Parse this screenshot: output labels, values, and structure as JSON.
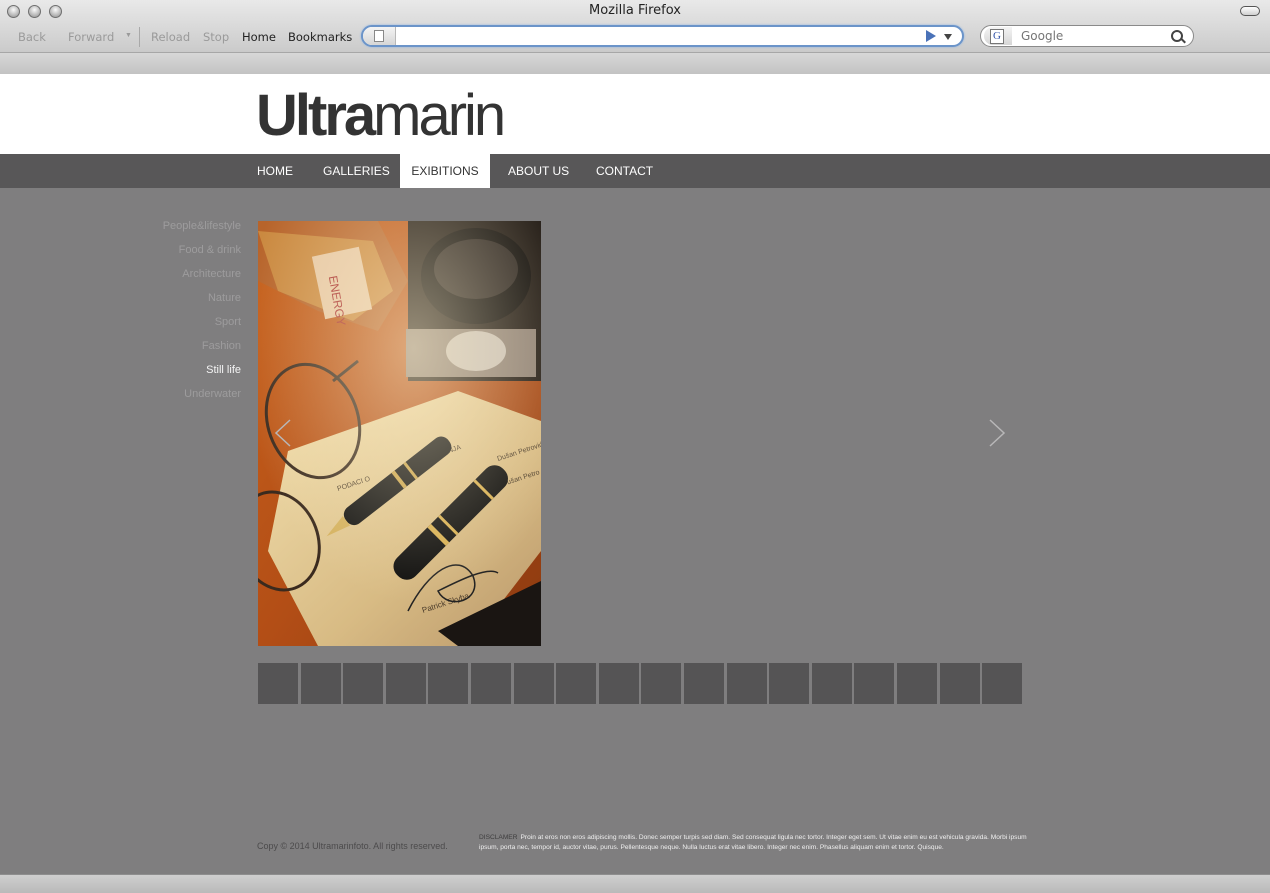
{
  "browser": {
    "title": "Mozilla Firefox",
    "nav": {
      "back": "Back",
      "forward": "Forward",
      "reload": "Reload",
      "stop": "Stop",
      "home": "Home",
      "bookmarks": "Bookmarks"
    },
    "url": "",
    "search_placeholder": "Google"
  },
  "site": {
    "logo_bold": "Ultra",
    "logo_light": "marin",
    "nav": [
      {
        "label": "HOME"
      },
      {
        "label": "GALLERIES"
      },
      {
        "label": "EXIBITIONS",
        "active": true
      },
      {
        "label": "ABOUT US"
      },
      {
        "label": "CONTACT"
      }
    ],
    "categories": [
      {
        "label": "People&lifestyle"
      },
      {
        "label": "Food & drink"
      },
      {
        "label": "Architecture"
      },
      {
        "label": "Nature"
      },
      {
        "label": "Sport"
      },
      {
        "label": "Fashion"
      },
      {
        "label": "Still life",
        "active": true
      },
      {
        "label": "Underwater"
      }
    ],
    "photo_alt": "Fountain pens on a signed document with glasses, ribbon and an inkwell",
    "thumbnail_count": 18,
    "footer": {
      "copyright": "Copy © 2014 Ultramarinfoto. All rights reserved.",
      "disclaimer_label": "DISCLAMER",
      "disclaimer_text": "Proin at eros non eros adipiscing mollis. Donec semper turpis sed diam. Sed consequat ligula nec tortor. Integer eget sem. Ut vitae enim eu est vehicula gravida. Morbi ipsum ipsum, porta nec, tempor id, auctor vitae, purus. Pellentesque neque. Nulla luctus erat vitae libero. Integer nec enim. Phasellus aliquam enim et tortor. Quisque."
    }
  },
  "colors": {
    "page_bg": "#7f7e7f",
    "nav_bg": "#585758",
    "thumb_bg": "#555455",
    "active_side": "#f4f4f4"
  }
}
